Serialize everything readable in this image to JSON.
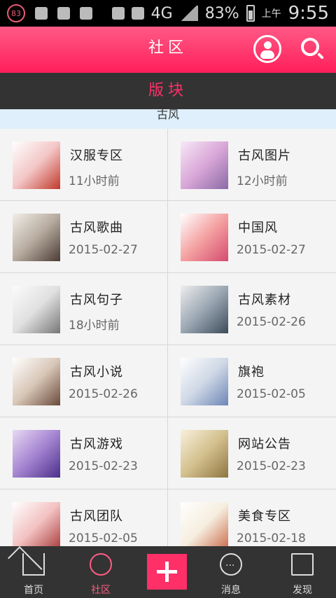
{
  "status_bar": {
    "badge": "83",
    "network": "4G",
    "battery": "83%",
    "time_prefix": "上午",
    "time": "9:55"
  },
  "header": {
    "title": "社区"
  },
  "section": {
    "title": "版块"
  },
  "subheader": {
    "text": "古风"
  },
  "boards": [
    {
      "name": "汉服专区",
      "date": "11小时前"
    },
    {
      "name": "古风图片",
      "date": "12小时前"
    },
    {
      "name": "古风歌曲",
      "date": "2015-02-27"
    },
    {
      "name": "中国风",
      "date": "2015-02-27"
    },
    {
      "name": "古风句子",
      "date": "18小时前"
    },
    {
      "name": "古风素材",
      "date": "2015-02-26"
    },
    {
      "name": "古风小说",
      "date": "2015-02-26"
    },
    {
      "name": "旗袍",
      "date": "2015-02-05"
    },
    {
      "name": "古风游戏",
      "date": "2015-02-23"
    },
    {
      "name": "网站公告",
      "date": "2015-02-23"
    },
    {
      "name": "古风团队",
      "date": "2015-02-05"
    },
    {
      "name": "美食专区",
      "date": "2015-02-18"
    }
  ],
  "bottom_nav": {
    "home": "首页",
    "community": "社区",
    "messages": "消息",
    "discover": "发现"
  }
}
